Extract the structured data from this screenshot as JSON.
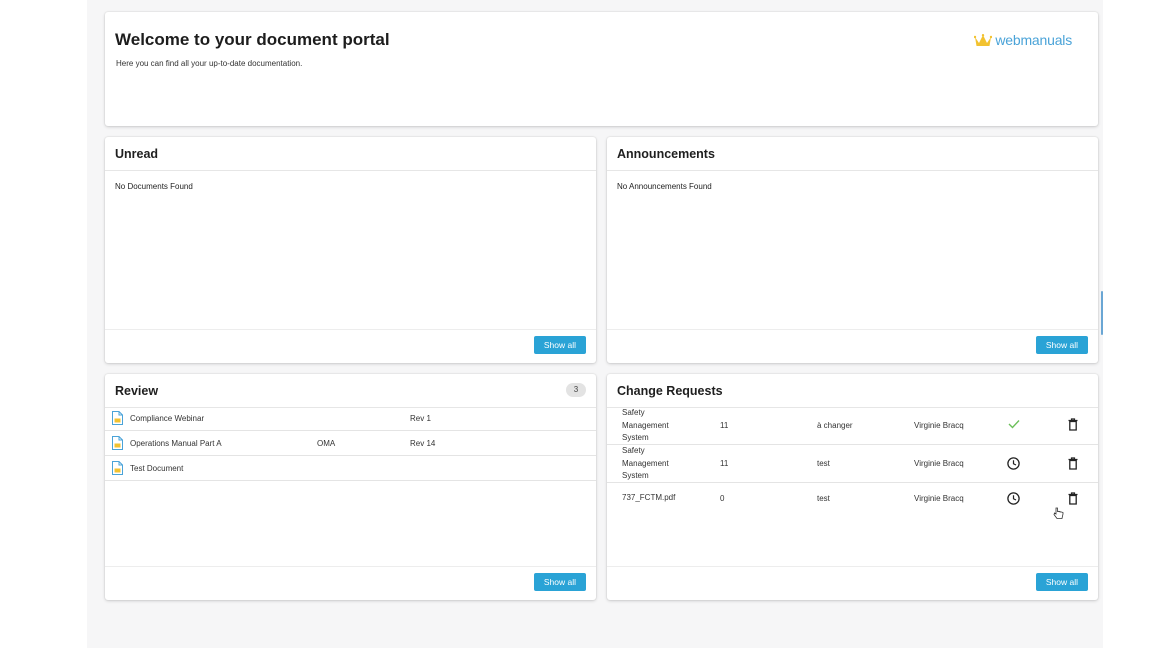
{
  "welcome": {
    "title": "Welcome to your document portal",
    "subtitle": "Here you can find all your up-to-date documentation.",
    "logo_text": "webmanuals",
    "logo_icon": "crown-icon",
    "logo_colors": {
      "crown": "#f2c230",
      "text": "#4aa3d8"
    }
  },
  "unread": {
    "title": "Unread",
    "empty_text": "No Documents Found",
    "show_all_label": "Show all"
  },
  "announcements": {
    "title": "Announcements",
    "empty_text": "No Announcements Found",
    "show_all_label": "Show all"
  },
  "review": {
    "title": "Review",
    "count": "3",
    "show_all_label": "Show all",
    "rows": [
      {
        "icon": "document-icon",
        "name": "Compliance Webinar",
        "code": "",
        "revision": "Rev 1"
      },
      {
        "icon": "document-icon",
        "name": "Operations Manual Part A",
        "code": "OMA",
        "revision": "Rev 14"
      },
      {
        "icon": "document-icon",
        "name": "Test Document",
        "code": "",
        "revision": ""
      }
    ]
  },
  "change_requests": {
    "title": "Change Requests",
    "show_all_label": "Show all",
    "rows": [
      {
        "name": "Safety Management System",
        "number": "11",
        "comment": "à changer",
        "author": "Virginie Bracq",
        "status_icon": "check-icon",
        "delete_icon": "trash-icon"
      },
      {
        "name": "Safety Management System",
        "number": "11",
        "comment": "test",
        "author": "Virginie Bracq",
        "status_icon": "clock-icon",
        "delete_icon": "trash-icon"
      },
      {
        "name": "737_FCTM.pdf",
        "number": "0",
        "comment": "test",
        "author": "Virginie Bracq",
        "status_icon": "clock-icon",
        "delete_icon": "trash-icon"
      }
    ]
  },
  "colors": {
    "accent": "#2aa3d6",
    "check": "#6bbf59",
    "background": "#f6f6f7"
  }
}
